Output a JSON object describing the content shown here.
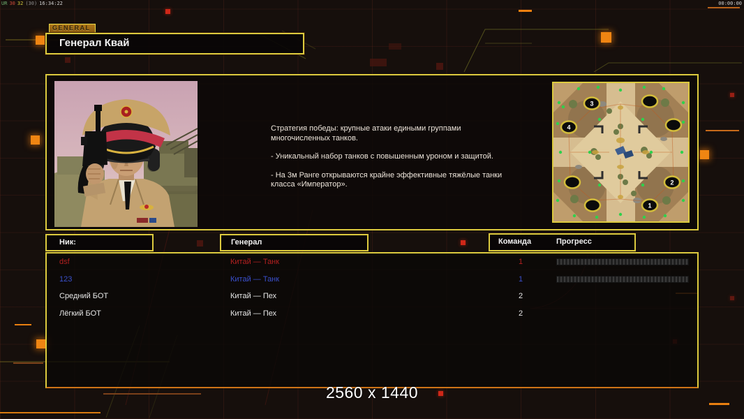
{
  "hud": {
    "debug_segments": [
      {
        "text": "UR",
        "color": "#6fae6f"
      },
      {
        "text": "30",
        "color": "#cf4a3a"
      },
      {
        "text": "32",
        "color": "#cfc43a"
      },
      {
        "text": "(30)",
        "color": "#8f8f8f"
      },
      {
        "text": "16:34:22",
        "color": "#cfcfcf"
      }
    ],
    "clock": "00:00:00",
    "resolution_label": "2560 x 1440"
  },
  "header": {
    "tab_label": "GENERAL",
    "title": "Генерал Квай"
  },
  "briefing": {
    "paragraphs": [
      "Стратегия победы: крупные атаки едиными группами\n многочисленных танков.",
      "- Уникальный набор танков с повышенным уроном и защитой.",
      "- На 3м Ранге открываются крайне эффективные тяжёлые танки\n класса «Император»."
    ]
  },
  "minimap": {
    "numbered_spots": [
      {
        "label": "1"
      },
      {
        "label": "2"
      },
      {
        "label": "3"
      },
      {
        "label": "4"
      }
    ]
  },
  "lobby_table": {
    "headers": {
      "nick": "Ник:",
      "general": "Генерал",
      "team": "Команда",
      "progress": "Прогресс"
    },
    "players": [
      {
        "nick": "dsf",
        "general": "Китай — Танк",
        "team": "1",
        "color": "#b32020",
        "has_progress": true
      },
      {
        "nick": "123",
        "general": "Китай — Танк",
        "team": "1",
        "color": "#3a50cc",
        "has_progress": true
      },
      {
        "nick": "Средний БОТ",
        "general": "Китай — Пех",
        "team": "2",
        "color": "#e6e6e6",
        "has_progress": false
      },
      {
        "nick": "Лёгкий БОТ",
        "general": "Китай — Пех",
        "team": "2",
        "color": "#e6e6e6",
        "has_progress": false
      }
    ]
  },
  "colors": {
    "accent_yellow": "#dcca3e",
    "accent_orange": "#ef8212",
    "player_red": "#b32020",
    "player_blue": "#3a50cc",
    "text_white": "#e6e6e6"
  }
}
